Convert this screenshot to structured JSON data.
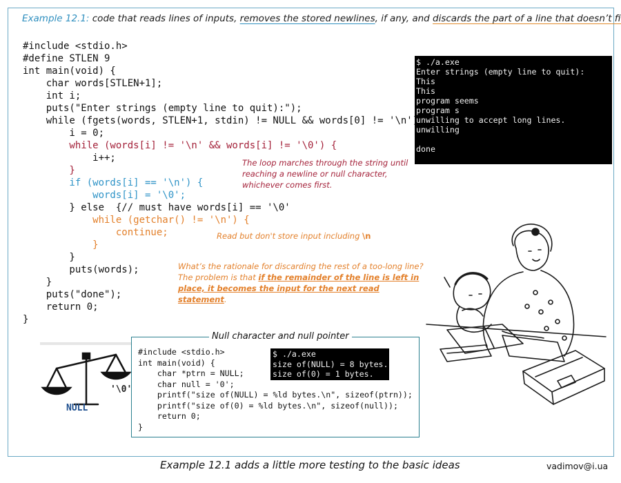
{
  "header": {
    "label": "Example 12.1:",
    "text_a": " code that reads lines of inputs, ",
    "text_b": "removes the stored newlines",
    "text_c": ", if any, and ",
    "text_d": "discards the part of a line that doesn’t fit",
    "text_e": "."
  },
  "code": {
    "l01": "#include <stdio.h>",
    "l02": "#define STLEN 9",
    "l03": "int main(void) {",
    "l04": "    char words[STLEN+1];",
    "l05": "    int i;",
    "l06": "    puts(\"Enter strings (empty line to quit):\");",
    "l07": "    while (fgets(words, STLEN+1, stdin) != NULL && words[0] != '\\n') {",
    "l08": "        i = 0;",
    "l09": "        while (words[i] != '\\n' && words[i] != '\\0') {",
    "l10": "            i++;",
    "l11": "        }",
    "l12": "        if (words[i] == '\\n') {",
    "l13": "            words[i] = '\\0';",
    "l14": "        } else  {// must have words[i] == '\\0'",
    "l15": "            while (getchar() != '\\n') {",
    "l16": "                continue;",
    "l17": "            }",
    "l18": "        }",
    "l19": "        puts(words);",
    "l20": "    }",
    "l21": "    puts(\"done\");",
    "l22": "    return 0;",
    "l23": "}"
  },
  "notes": {
    "loop": "The loop marches through the string until reaching a newline or null character, whichever comes first.",
    "discard_a": "Read but don't store input including ",
    "discard_b": "\\n",
    "question": "What’s the rationale for discarding the rest of a too-long line?",
    "answer_a": "The problem is that ",
    "answer_b": "if the remainder of the line is left in place, it becomes the input for the next read statement",
    "answer_c": "."
  },
  "terminal1": {
    "lines": [
      "$ ./a.exe",
      "Enter strings (empty line to quit):",
      "This",
      "This",
      "program seems",
      "program s",
      "unwilling to accept long lines.",
      "unwilling",
      "",
      "done"
    ]
  },
  "nullbox": {
    "title": "Null character and null pointer",
    "code": [
      "#include <stdio.h>",
      "int main(void) {",
      "    char *ptrn = NULL;",
      "    char null = '0';",
      "    printf(\"size of(NULL) = %ld bytes.\\n\", sizeof(ptrn));",
      "    printf(\"size of(0) = %ld bytes.\\n\", sizeof(null));",
      "    return 0;",
      "}"
    ],
    "terminal": [
      "$ ./a.exe",
      "size of(NULL) = 8 bytes.",
      "size of(0) = 1 bytes."
    ]
  },
  "scale": {
    "left_label": "NULL",
    "right_label": "'\\0'"
  },
  "footer": {
    "caption": "Example 12.1 adds a little more testing to the basic ideas",
    "email": "vadimov@i.ua"
  },
  "colors": {
    "frame": "#6aa9c4",
    "red": "#a4223a",
    "blue": "#2e93c7",
    "orange": "#e3802b"
  }
}
